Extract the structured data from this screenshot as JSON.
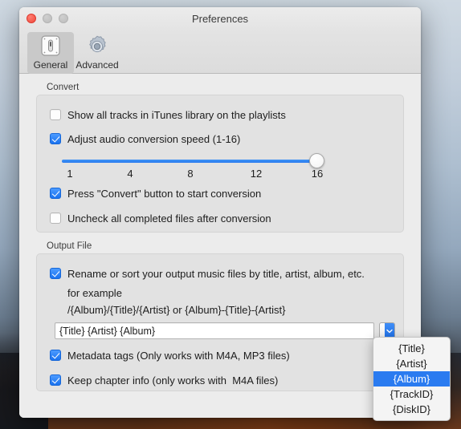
{
  "window": {
    "title": "Preferences",
    "controls": {
      "close": "close-button",
      "minimize": "minimize-button",
      "zoom": "zoom-button"
    }
  },
  "toolbar": {
    "items": [
      {
        "label": "General",
        "icon": "switch-icon",
        "selected": true
      },
      {
        "label": "Advanced",
        "icon": "gear-icon",
        "selected": false
      }
    ]
  },
  "convert": {
    "group_label": "Convert",
    "show_all_tracks": {
      "label": "Show all tracks in iTunes library on the playlists",
      "checked": false
    },
    "adjust_speed": {
      "label": "Adjust audio conversion speed (1-16)",
      "checked": true
    },
    "slider": {
      "min": 1,
      "max": 16,
      "value": 16,
      "ticks": [
        "1",
        "4",
        "8",
        "12",
        "16"
      ]
    },
    "press_convert": {
      "label": "Press \"Convert\" button to start conversion",
      "checked": true
    },
    "uncheck_completed": {
      "label": "Uncheck all completed files after conversion",
      "checked": false
    }
  },
  "output_file": {
    "group_label": "Output File",
    "rename_sort": {
      "label": "Rename or sort your output music files by title, artist, album, etc.",
      "checked": true
    },
    "example_intro": "for example",
    "example_pattern": "/{Album}/{Title}/{Artist} or {Album}-{Title}-{Artist}",
    "pattern_input": {
      "value": "{Title} {Artist} {Album}",
      "placeholder": ""
    },
    "popup_button_icon": "chevron-down-icon",
    "metadata_tags": {
      "label": "Metadata tags (Only works with M4A, MP3 files)",
      "checked": true
    },
    "keep_chapter": {
      "label": "Keep chapter info (only works with  M4A files)",
      "checked": true
    }
  },
  "dropdown": {
    "open": true,
    "selected": "{Album}",
    "options": [
      "{Title}",
      "{Artist}",
      "{Album}",
      "{TrackID}",
      "{DiskID}"
    ]
  },
  "colors": {
    "accent": "#2a7bf0",
    "window_bg": "#ececec",
    "group_bg": "#e2e2e2",
    "close_red": "#f0483c"
  }
}
